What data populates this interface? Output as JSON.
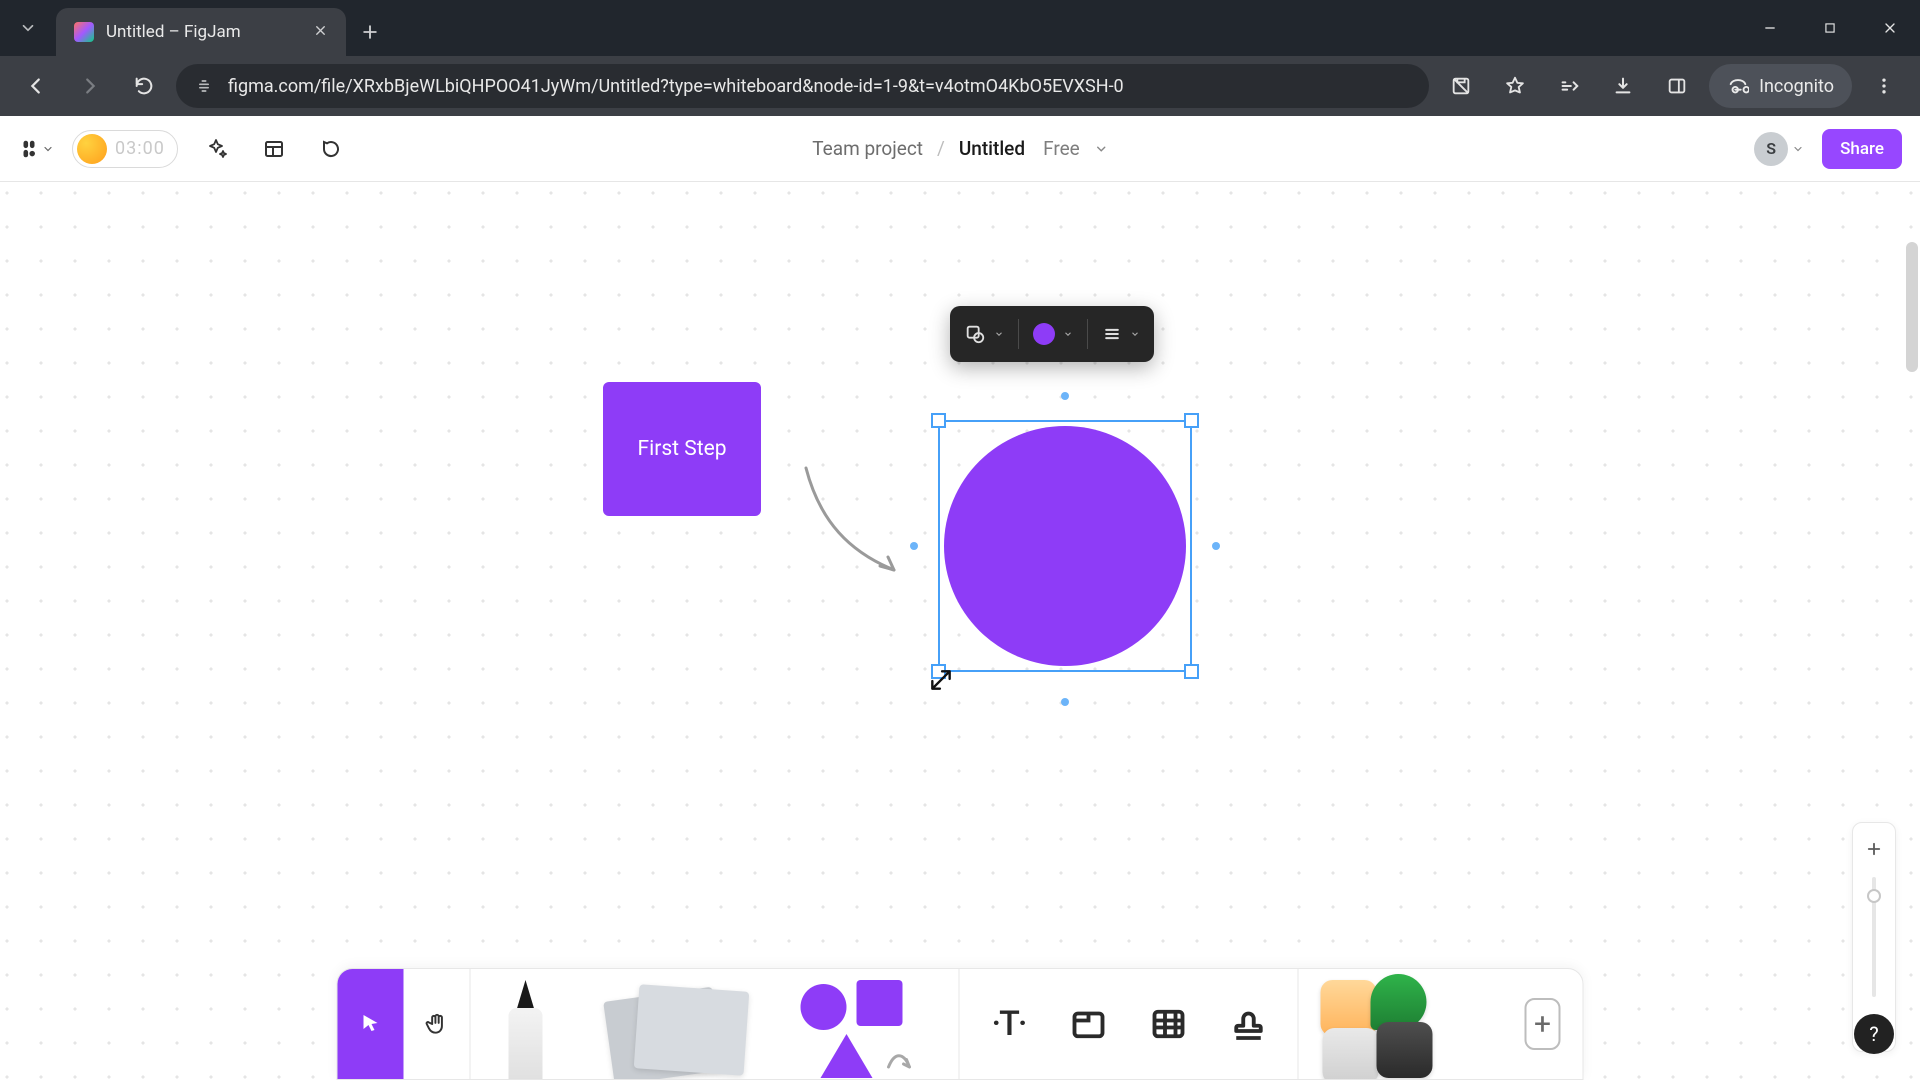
{
  "browser": {
    "tab_title": "Untitled – FigJam",
    "url": "figma.com/file/XRxbBjeWLbiQHPOO41JyWm/Untitled?type=whiteboard&node-id=1-9&t=v4otmO4KbO5EVXSH-0",
    "incognito_label": "Incognito"
  },
  "topbar": {
    "timer": "03:00",
    "project": "Team project",
    "separator": "/",
    "doc_title": "Untitled",
    "plan": "Free",
    "user_initial": "S",
    "share_label": "Share"
  },
  "canvas": {
    "rect_label": "First Step"
  },
  "colors": {
    "accent": "#8e3cf7",
    "selection": "#46a0f8"
  }
}
